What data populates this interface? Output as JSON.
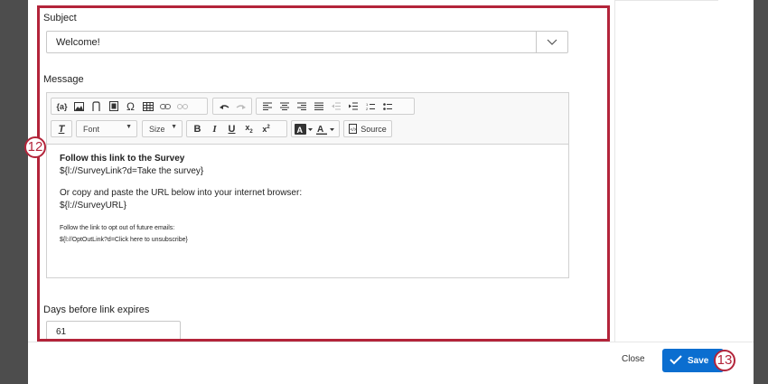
{
  "form": {
    "subject_label": "Subject",
    "subject_value": "Welcome!",
    "message_label": "Message",
    "days_label": "Days before link expires",
    "days_value": "61"
  },
  "toolbar": {
    "piped_text": "{a}",
    "font_label": "Font",
    "size_label": "Size",
    "bold": "B",
    "italic": "I",
    "underline": "U",
    "source_label": "Source"
  },
  "message_body": {
    "heading": "Follow this link to the Survey",
    "survey_link": "${l://SurveyLink?d=Take the survey}",
    "copy_paste": "Or copy and paste the URL below into your internet browser:",
    "survey_url": "${l://SurveyURL}",
    "opt_out_text": "Follow the link to opt out of future emails:",
    "opt_out_link": "${l://OptOutLink?d=Click here to unsubscribe}"
  },
  "footer": {
    "close_label": "Close",
    "save_label": "Save"
  },
  "callouts": {
    "editor_step": "12",
    "save_step": "13"
  },
  "colors": {
    "callout": "#b3243a",
    "primary_button": "#0b6ed0"
  }
}
